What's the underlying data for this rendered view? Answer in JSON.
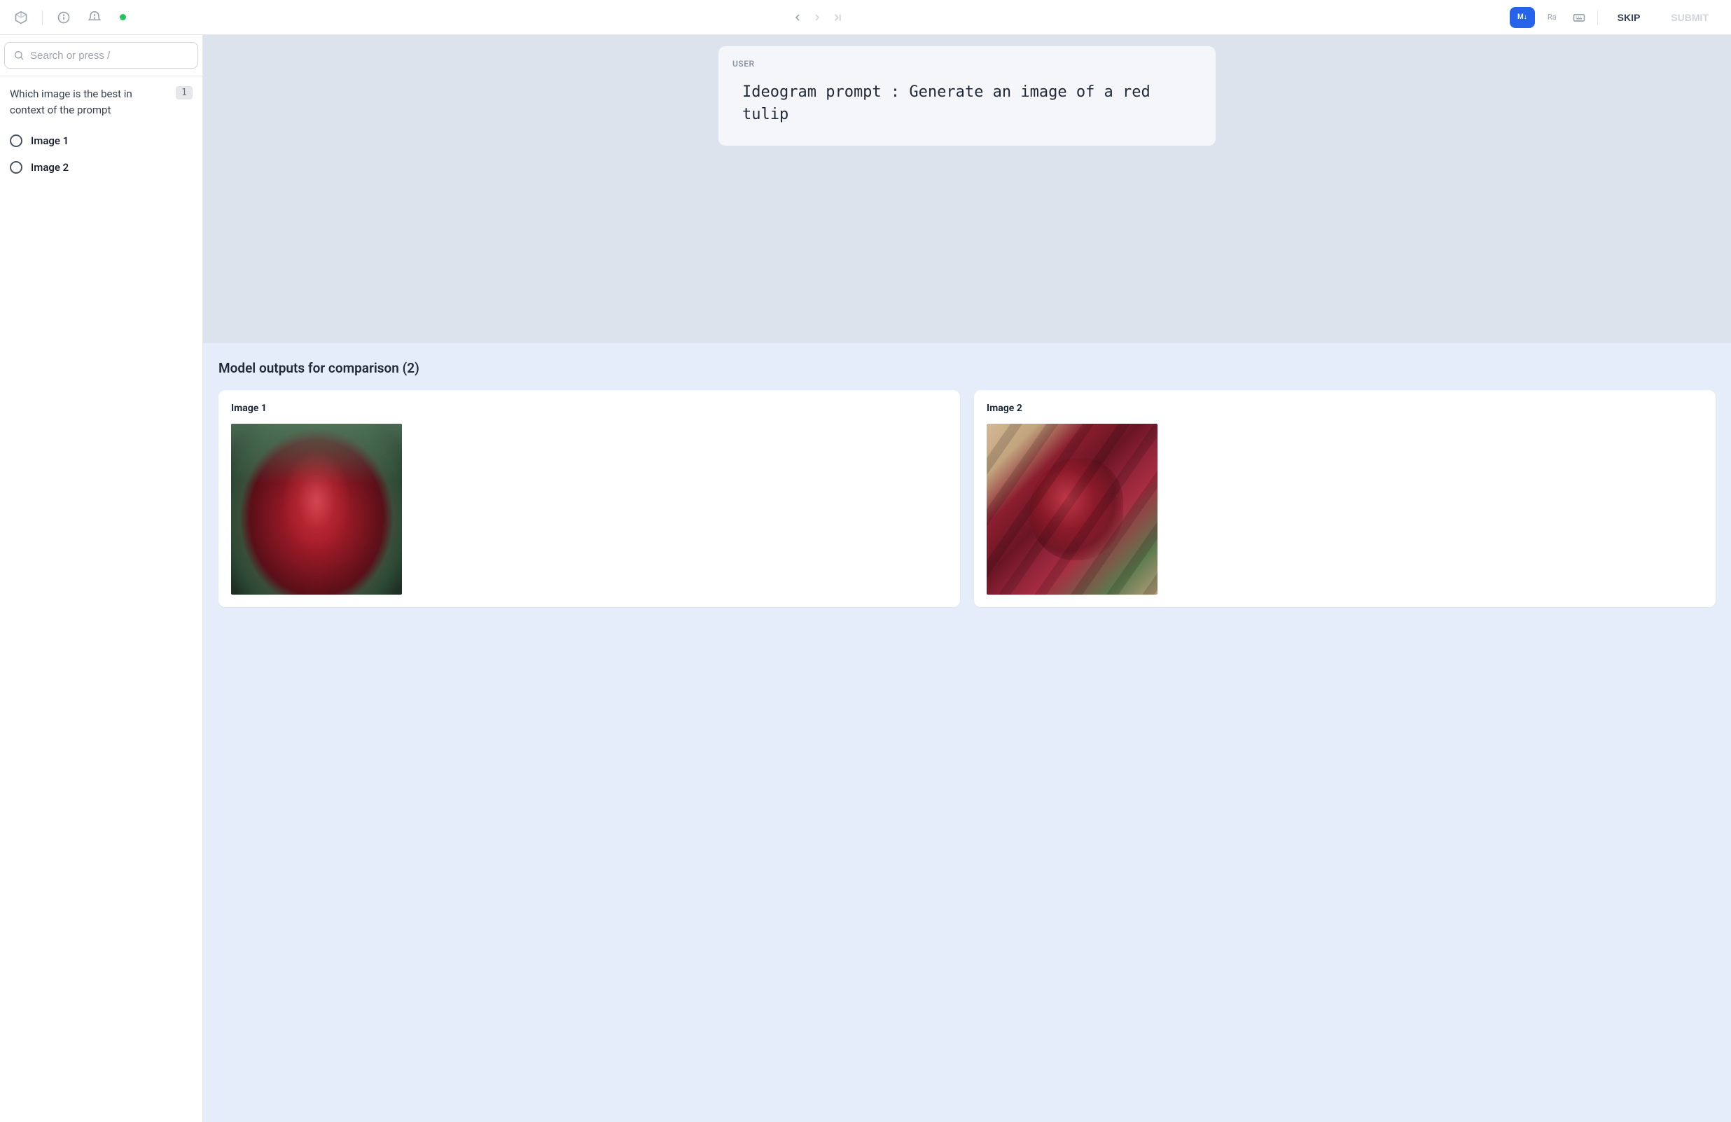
{
  "toolbar": {
    "md_label": "M↓",
    "ra_label": "Ra",
    "skip_label": "SKIP",
    "submit_label": "SUBMIT"
  },
  "sidebar": {
    "search_placeholder": "Search or press /",
    "question": {
      "text": "Which image is the best in context of the prompt",
      "badge": "1",
      "options": [
        {
          "label": "Image 1"
        },
        {
          "label": "Image 2"
        }
      ]
    }
  },
  "main": {
    "prompt": {
      "role": "USER",
      "text": "Ideogram prompt : Generate an image of a red tulip"
    },
    "outputs": {
      "heading": "Model outputs for comparison (2)",
      "cards": [
        {
          "title": "Image 1"
        },
        {
          "title": "Image 2"
        }
      ]
    }
  }
}
